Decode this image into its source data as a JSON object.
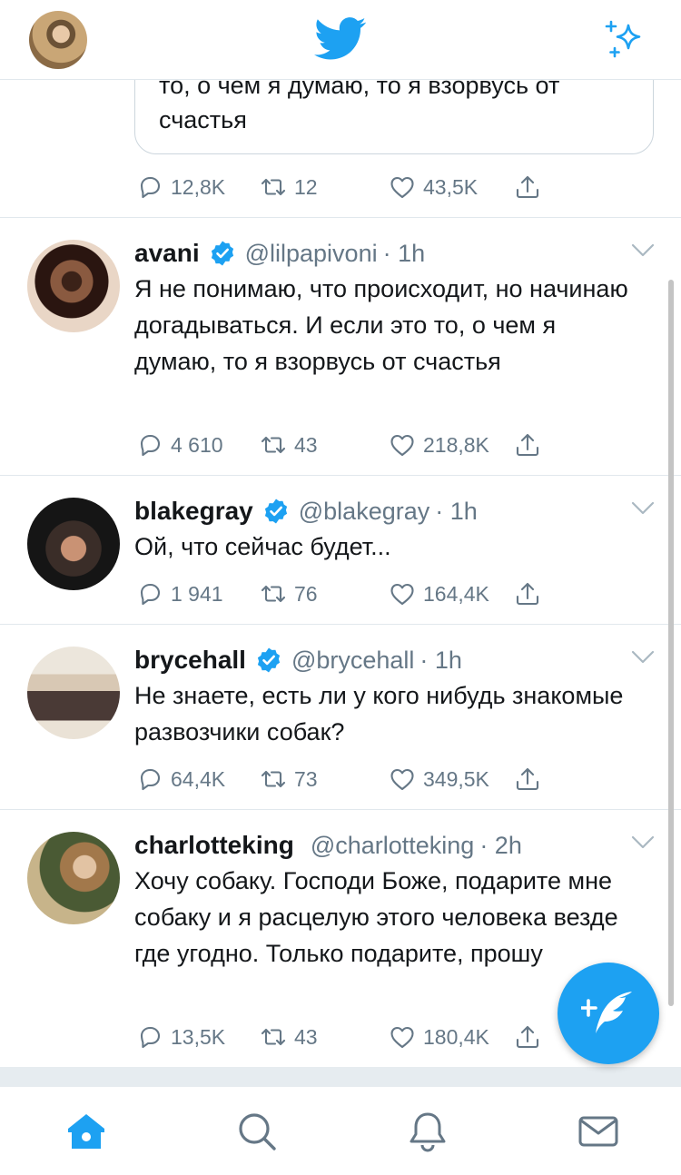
{
  "colors": {
    "brand": "#1da1f2",
    "muted": "#657786",
    "text": "#14171a",
    "border": "#e1e8ed"
  },
  "header": {
    "avatar_icon": "profile-avatar",
    "logo_icon": "twitter-bird-icon",
    "right_icon": "sparkle-icon"
  },
  "quote": {
    "line1": "то, о чем я думаю, то я взорвусь от",
    "line2": "счастья"
  },
  "top_actions": {
    "replies": "12,8K",
    "retweets": "12",
    "likes": "43,5K"
  },
  "tweets": [
    {
      "name": "avani",
      "handle": "@lilpapivoni",
      "time": "· 1h",
      "verified": true,
      "text": "Я не понимаю, что происходит, но начинаю догадываться. И если это то, о чем я думаю, то я взорвусь от счастья",
      "replies": "4 610",
      "retweets": "43",
      "likes": "218,8K"
    },
    {
      "name": "blakegray",
      "handle": "@blakegray",
      "time": "· 1h",
      "verified": true,
      "text": "Ой, что сейчас будет...",
      "replies": "1 941",
      "retweets": "76",
      "likes": "164,4K"
    },
    {
      "name": "brycehall",
      "handle": "@brycehall",
      "time": "· 1h",
      "verified": true,
      "text": "Не знаете, есть ли у кого нибудь знакомые развозчики собак?",
      "replies": "64,4K",
      "retweets": "73",
      "likes": "349,5K"
    },
    {
      "name": "charlotteking",
      "handle": "@charlotteking",
      "time": "· 2h",
      "verified": false,
      "text": "Хочу собаку. Господи Боже, подарите мне собаку и я расцелую этого человека везде где угодно. Только подарите, прошу",
      "replies": "13,5K",
      "retweets": "43",
      "likes": "180,4K"
    }
  ],
  "nav": [
    {
      "icon": "home-icon",
      "active": true
    },
    {
      "icon": "search-icon",
      "active": false
    },
    {
      "icon": "notifications-icon",
      "active": false
    },
    {
      "icon": "messages-icon",
      "active": false
    }
  ],
  "fab": {
    "icon": "compose-tweet-icon"
  }
}
